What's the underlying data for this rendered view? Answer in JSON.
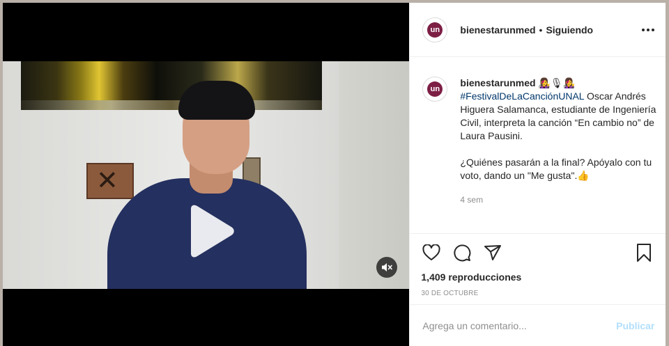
{
  "post": {
    "header": {
      "avatar_text": "un",
      "username": "bienestarunmed",
      "separator": "•",
      "follow_status": "Siguiendo",
      "more_icon": "more-horizontal-icon"
    },
    "caption": {
      "username": "bienestarunmed",
      "emojis": "👩‍🎤🎙👩‍🎤",
      "hashtag": "#FestivalDeLaCanciónUNAL",
      "text1": " Oscar Andrés Higuera Salamanca, estudiante de Ingeniería Civil, interpreta la canción “En cambio no” de Laura Pausini.",
      "text2": "¿Quiénes pasarán a la final? Apóyalo con tu voto, dando un \"Me gusta\".",
      "thumb": "👍",
      "time_ago": "4 sem"
    },
    "actions": {
      "like_icon": "heart-icon",
      "comment_icon": "comment-icon",
      "share_icon": "paper-plane-icon",
      "save_icon": "bookmark-icon"
    },
    "views": "1,409 reproducciones",
    "date": "30 DE OCTUBRE",
    "comment": {
      "placeholder": "Agrega un comentario...",
      "publish_label": "Publicar"
    }
  },
  "video": {
    "play_icon": "play-icon",
    "audio_icon": "speaker-muted-icon"
  },
  "colors": {
    "hashtag": "#00376b",
    "publish": "#b2dffc",
    "avatar": "#7d1f45"
  }
}
